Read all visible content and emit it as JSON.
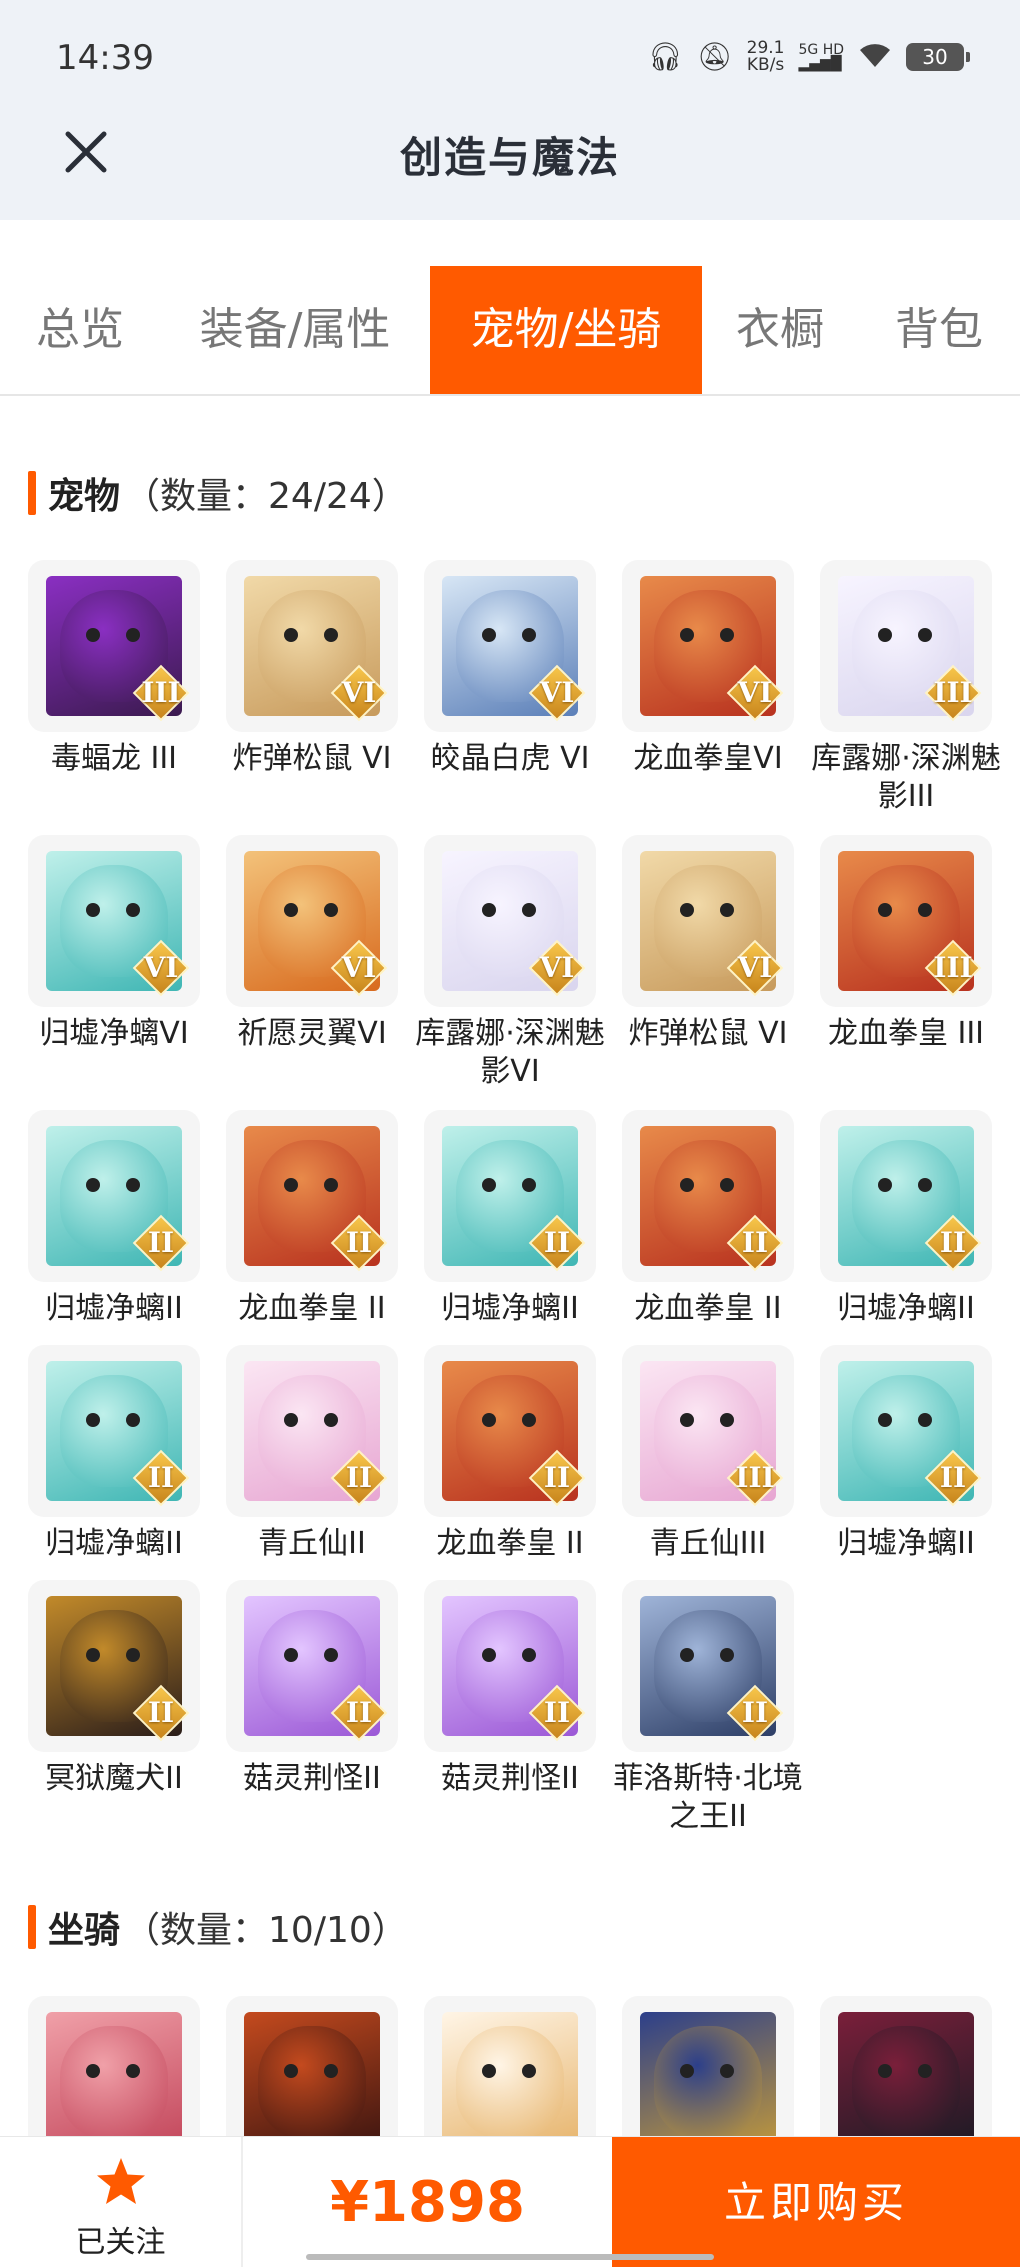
{
  "status_bar": {
    "time": "14:39",
    "speed_value": "29.1",
    "speed_unit": "KB/s",
    "network": "5G HD",
    "battery": "30"
  },
  "header": {
    "title": "创造与魔法"
  },
  "tabs": [
    {
      "label": "总览",
      "active": false
    },
    {
      "label": "装备/属性",
      "active": false
    },
    {
      "label": "宠物/坐骑",
      "active": true
    },
    {
      "label": "衣橱",
      "active": false
    },
    {
      "label": "背包",
      "active": false
    }
  ],
  "pets_section": {
    "title": "宠物",
    "count": "（数量：24/24）"
  },
  "pets": [
    {
      "name": "毒蝠龙 III",
      "tier": "III",
      "palette": "purple"
    },
    {
      "name": "炸弹松鼠 VI",
      "tier": "VI",
      "palette": "tan"
    },
    {
      "name": "皎晶白虎 VI",
      "tier": "VI",
      "palette": "blue"
    },
    {
      "name": "龙血拳皇VI",
      "tier": "VI",
      "palette": "red"
    },
    {
      "name": "库露娜·深渊魅影III",
      "tier": "III",
      "palette": "white"
    },
    {
      "name": "归墟净螭VI",
      "tier": "VI",
      "palette": "teal"
    },
    {
      "name": "祈愿灵翼VI",
      "tier": "VI",
      "palette": "orange"
    },
    {
      "name": "库露娜·深渊魅影VI",
      "tier": "VI",
      "palette": "white"
    },
    {
      "name": "炸弹松鼠 VI",
      "tier": "VI",
      "palette": "tan"
    },
    {
      "name": "龙血拳皇 III",
      "tier": "III",
      "palette": "red"
    },
    {
      "name": "归墟净螭II",
      "tier": "II",
      "palette": "teal"
    },
    {
      "name": "龙血拳皇 II",
      "tier": "II",
      "palette": "red"
    },
    {
      "name": "归墟净螭II",
      "tier": "II",
      "palette": "teal"
    },
    {
      "name": "龙血拳皇 II",
      "tier": "II",
      "palette": "red"
    },
    {
      "name": "归墟净螭II",
      "tier": "II",
      "palette": "teal"
    },
    {
      "name": "归墟净螭II",
      "tier": "II",
      "palette": "teal"
    },
    {
      "name": "青丘仙II",
      "tier": "II",
      "palette": "pink"
    },
    {
      "name": "龙血拳皇 II",
      "tier": "II",
      "palette": "red"
    },
    {
      "name": "青丘仙III",
      "tier": "III",
      "palette": "pink"
    },
    {
      "name": "归墟净螭II",
      "tier": "II",
      "palette": "teal"
    },
    {
      "name": "冥狱魔犬II",
      "tier": "II",
      "palette": "dark"
    },
    {
      "name": "菇灵荆怪II",
      "tier": "II",
      "palette": "violet"
    },
    {
      "name": "菇灵荆怪II",
      "tier": "II",
      "palette": "violet"
    },
    {
      "name": "菲洛斯特·北境之王II",
      "tier": "II",
      "palette": "navy"
    }
  ],
  "mounts_section": {
    "title": "坐骑",
    "count": "（数量：10/10）"
  },
  "mounts": [
    {
      "palette": "pinkred"
    },
    {
      "palette": "darkred"
    },
    {
      "palette": "cat"
    },
    {
      "palette": "gold"
    },
    {
      "palette": "black"
    }
  ],
  "palettes": {
    "purple": [
      "#3b1a4f",
      "#8a2fc2"
    ],
    "tan": [
      "#c79a5c",
      "#f1d9a8"
    ],
    "blue": [
      "#5b7fb8",
      "#d7e6f5"
    ],
    "red": [
      "#b8321f",
      "#e88a4a"
    ],
    "white": [
      "#d9d5ee",
      "#f7f4ff"
    ],
    "teal": [
      "#3fb6b4",
      "#bff0ea"
    ],
    "orange": [
      "#d86a1e",
      "#f3c27a"
    ],
    "pink": [
      "#e7a6d2",
      "#fbe6f3"
    ],
    "dark": [
      "#2a1d1a",
      "#c28a2a"
    ],
    "violet": [
      "#9b58d6",
      "#e3c5ff"
    ],
    "navy": [
      "#2d3e66",
      "#9fb4d8"
    ],
    "pinkred": [
      "#c2455a",
      "#f0a0a8"
    ],
    "darkred": [
      "#3a1410",
      "#c44a1e"
    ],
    "cat": [
      "#e6b36a",
      "#fff5e6"
    ],
    "gold": [
      "#c39a3a",
      "#2c3f8a"
    ],
    "black": [
      "#1a1a24",
      "#7a1f3a"
    ]
  },
  "bottom_bar": {
    "follow_label": "已关注",
    "price": "¥1898",
    "buy_label": "立即购买"
  },
  "colors": {
    "accent": "#ff5a00",
    "header_bg": "#eef2f7"
  }
}
